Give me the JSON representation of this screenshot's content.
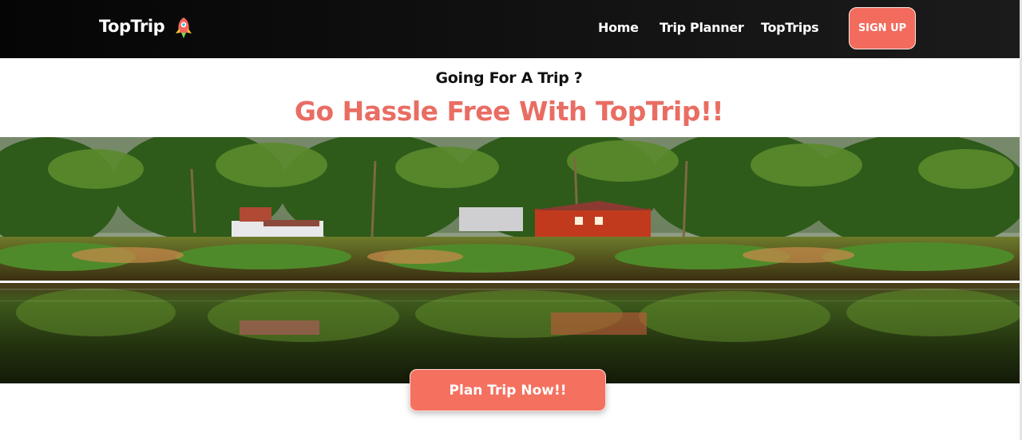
{
  "nav": {
    "brand": "TopTrip",
    "brand_icon": "rocket-icon",
    "links": [
      "Home",
      "Trip Planner",
      "TopTrips"
    ],
    "signup_label": "SIGN UP"
  },
  "hero": {
    "kicker": "Going For A Trip ?",
    "headline": "Go Hassle Free With TopTrip!!",
    "image_subject": "palm trees and houses reflected in a lake",
    "cta_label": "Plan Trip Now!!"
  },
  "colors": {
    "accent": "#f26b5c",
    "headline": "#e96d63",
    "nav_bg": "#0a0a0a"
  }
}
